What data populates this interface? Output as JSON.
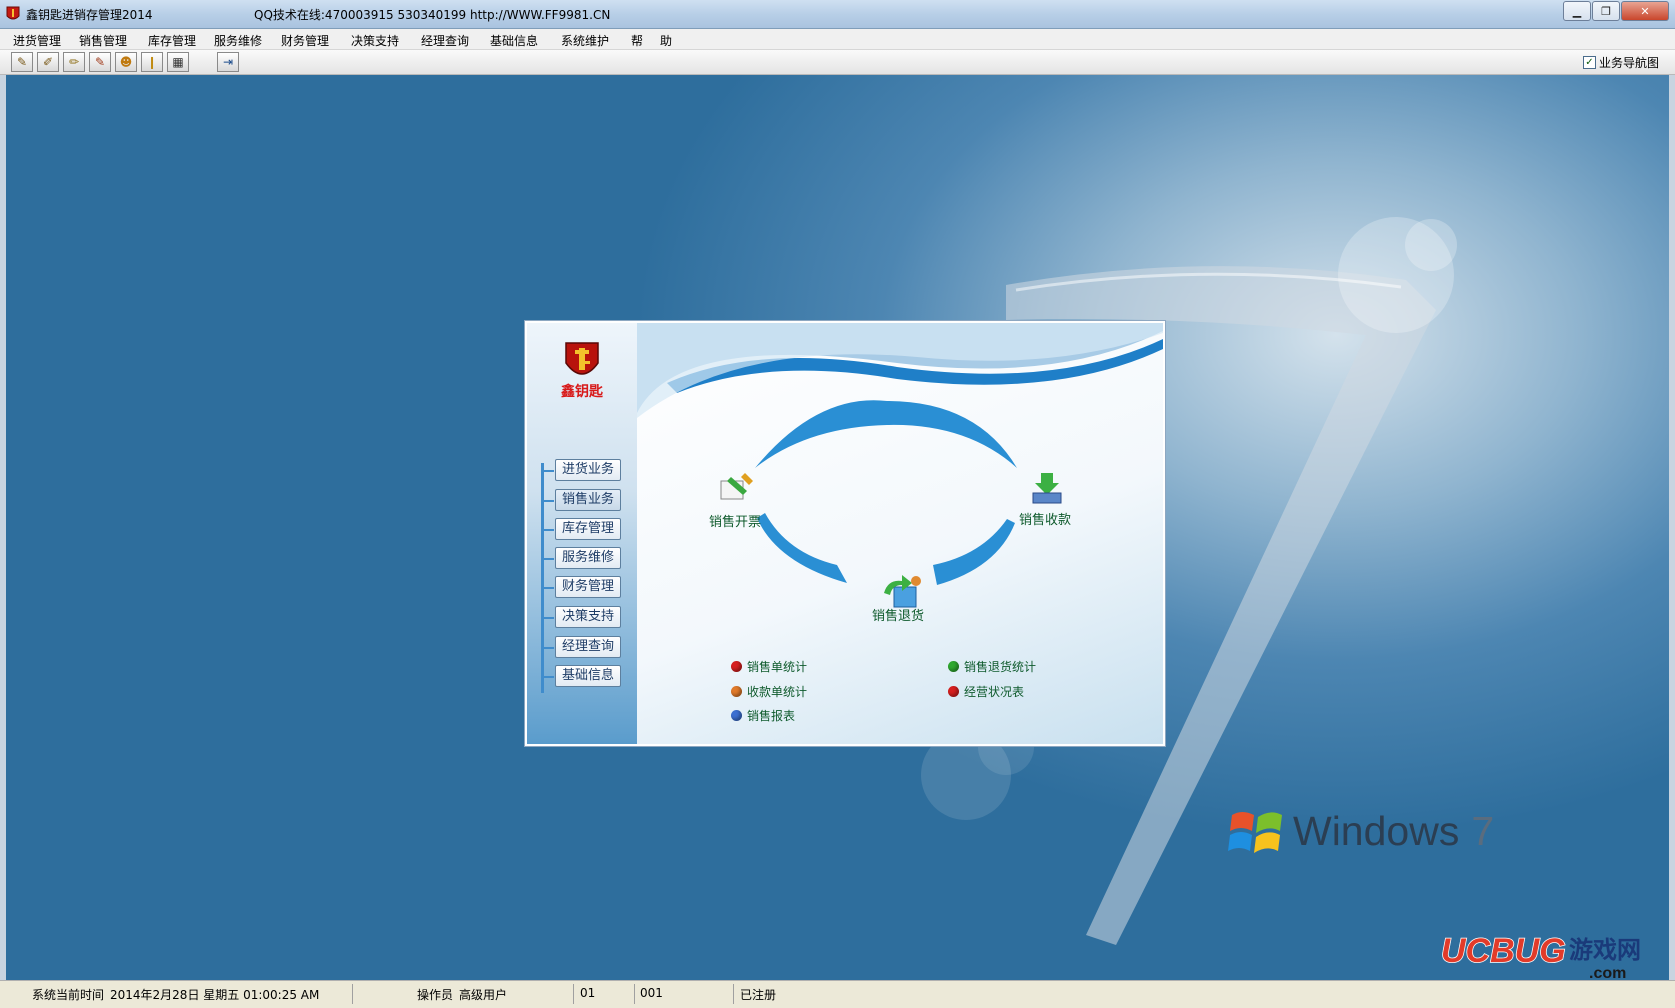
{
  "window": {
    "title": "鑫钥匙进销存管理2014",
    "info": "QQ技术在线:470003915  530340199  http://WWW.FF9981.CN",
    "controls": [
      "minimize",
      "maximize",
      "close"
    ]
  },
  "menu": {
    "items": [
      "进货管理",
      "销售管理",
      "库存管理",
      "服务维修",
      "财务管理",
      "决策支持",
      "经理查询",
      "基础信息",
      "系统维护",
      "帮",
      "助"
    ]
  },
  "toolbar": {
    "buttons": [
      "purchase-icon",
      "sales-icon",
      "stock-icon",
      "service-icon",
      "customer-icon",
      "finance-icon",
      "calculator-icon",
      "exit-icon"
    ],
    "nav_toggle_label": "业务导航图",
    "nav_toggle_checked": true
  },
  "navigator": {
    "brand": "鑫钥匙",
    "side_buttons": [
      "进货业务",
      "销售业务",
      "库存管理",
      "服务维修",
      "财务管理",
      "决策支持",
      "经理查询",
      "基础信息"
    ],
    "active_button": "销售业务",
    "flow": {
      "invoice": "销售开票",
      "receipt": "销售收款",
      "return": "销售退货"
    },
    "reports": [
      {
        "label": "销售单统计",
        "color": "#d61f1f"
      },
      {
        "label": "销售退货统计",
        "color": "#2fa82f"
      },
      {
        "label": "收款单统计",
        "color": "#e07a2a"
      },
      {
        "label": "经营状况表",
        "color": "#d61f1f"
      },
      {
        "label": "销售报表",
        "color": "#3c6fd1"
      }
    ]
  },
  "desktop": {
    "brand_text": "Windows",
    "brand_version": "7",
    "watermark": "UCBUG游戏网",
    "watermark_sub": ".com"
  },
  "status": {
    "time_label": "系统当前时间",
    "datetime": "2014年2月28日 星期五 01:00:25 AM",
    "operator_label": "操作员",
    "operator": "高级用户",
    "code1": "01",
    "code2": "001",
    "registration": "已注册"
  },
  "colors": {
    "accent": "#3f8ccc",
    "brand_red": "#d81a1a",
    "flow_text": "#0e5a2c"
  }
}
